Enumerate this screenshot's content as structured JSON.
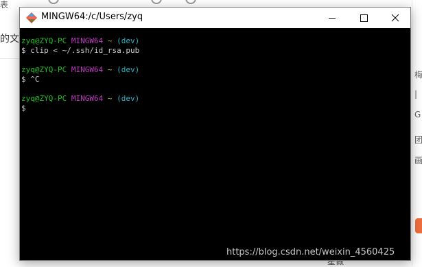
{
  "background": {
    "left_top_fragment": "表",
    "left_line_fragment": "的文档",
    "right_glyphs": [
      "梅",
      "|",
      "G",
      "团",
      "画"
    ],
    "bottom_text": "星做"
  },
  "window": {
    "title": "MINGW64:/c/Users/zyq",
    "icon": "git-bash-icon",
    "controls": {
      "minimize": "minimize-icon",
      "maximize": "maximize-icon",
      "close": "close-icon"
    }
  },
  "terminal": {
    "colors": {
      "user": "#19c419",
      "system": "#c13ac1",
      "path": "#c7c400",
      "branch": "#28b6c8",
      "text": "#cccccc",
      "background": "#000000"
    },
    "prompt": {
      "user_host": "zyq@ZYQ-PC",
      "system": "MINGW64",
      "path": "~",
      "branch": "(dev)"
    },
    "blocks": [
      {
        "command": "$ clip < ~/.ssh/id_rsa.pub"
      },
      {
        "command": "$ ^C"
      },
      {
        "command": "$"
      }
    ]
  },
  "watermark": "https://blog.csdn.net/weixin_4560425"
}
